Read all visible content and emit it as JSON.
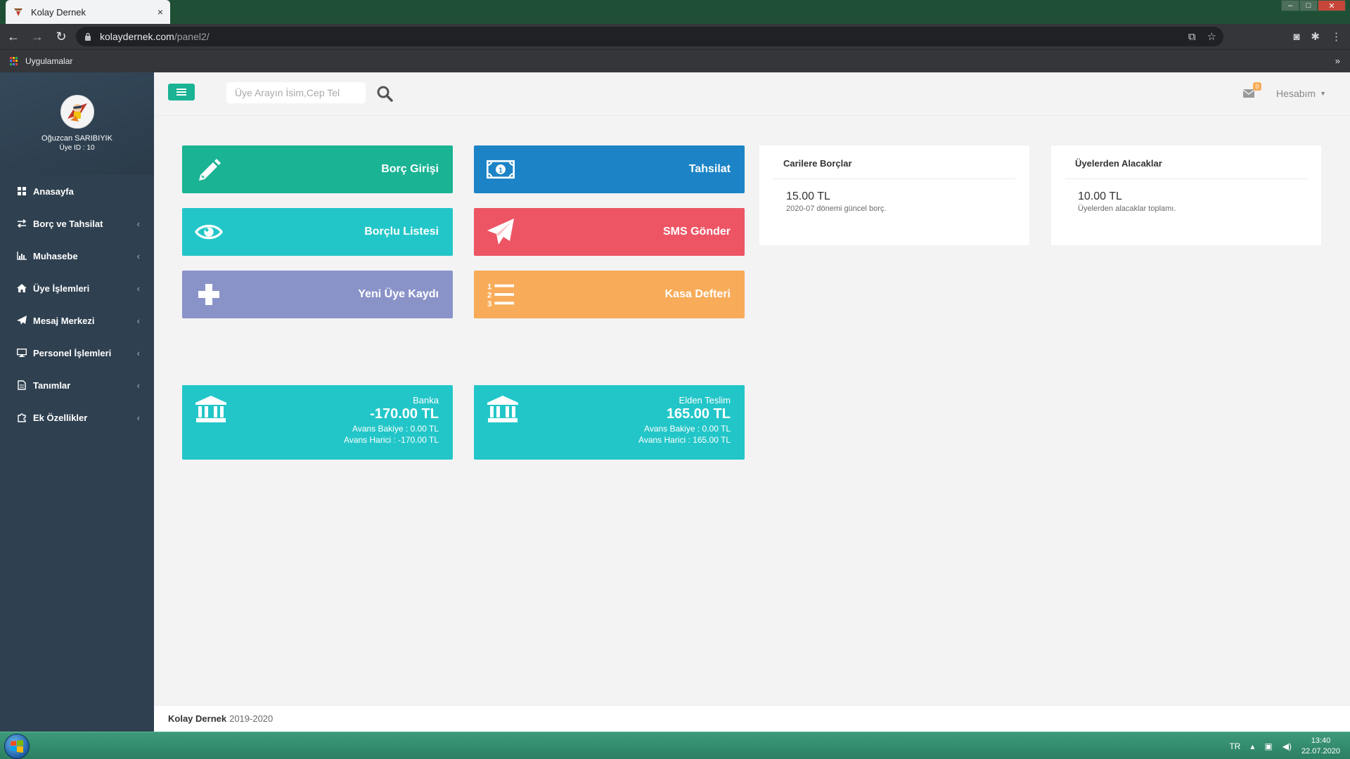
{
  "browser": {
    "tab_title": "Kolay Dernek",
    "tab_close": "×",
    "url_host": "kolaydernek.com",
    "url_path": "/panel2/",
    "bookmark_apps": "Uygulamalar",
    "bookmark_more": "»"
  },
  "profile": {
    "name": "Oğuzcan SARIBIYIK",
    "id_label": "Üye ID : 10"
  },
  "menu": [
    {
      "label": "Anasayfa",
      "icon": "dashboard-icon",
      "has_arrow": false
    },
    {
      "label": "Borç ve Tahsilat",
      "icon": "exchange-icon",
      "has_arrow": true
    },
    {
      "label": "Muhasebe",
      "icon": "bar-chart-icon",
      "has_arrow": true
    },
    {
      "label": "Üye İşlemleri",
      "icon": "home-icon",
      "has_arrow": true
    },
    {
      "label": "Mesaj Merkezi",
      "icon": "paper-plane-icon",
      "has_arrow": true
    },
    {
      "label": "Personel İşlemleri",
      "icon": "desktop-icon",
      "has_arrow": true
    },
    {
      "label": "Tanımlar",
      "icon": "file-icon",
      "has_arrow": true
    },
    {
      "label": "Ek Özellikler",
      "icon": "puzzle-icon",
      "has_arrow": true
    }
  ],
  "menu_arrow": "‹",
  "topbar": {
    "search_placeholder": "Üye Arayın İsim,Cep Tel",
    "mail_count": "0",
    "account_label": "Hesabım"
  },
  "tiles": [
    {
      "label": "Borç Girişi",
      "color": "#1ab394",
      "icon": "pencil-icon"
    },
    {
      "label": "Tahsilat",
      "color": "#1c84c6",
      "icon": "money-icon"
    },
    {
      "label": "Borçlu Listesi",
      "color": "#23c6c8",
      "icon": "eye-icon"
    },
    {
      "label": "SMS Gönder",
      "color": "#ed5565",
      "icon": "paper-plane-icon"
    },
    {
      "label": "Yeni Üye Kaydı",
      "color": "#8a93c8",
      "icon": "plus-icon"
    },
    {
      "label": "Kasa Defteri",
      "color": "#f8ac59",
      "icon": "list-ol-icon"
    }
  ],
  "widgets": [
    {
      "title": "Carilere Borçlar",
      "value": "15.00 TL",
      "sub": "2020-07 dönemi güncel borç."
    },
    {
      "title": "Üyelerden Alacaklar",
      "value": "10.00 TL",
      "sub": "Üyelerden alacaklar toplamı."
    }
  ],
  "banks": [
    {
      "name": "Banka",
      "amount": "-170.00 TL",
      "line1": "Avans Bakiye : 0.00 TL",
      "line2": "Avans Harici : -170.00 TL"
    },
    {
      "name": "Elden Teslim",
      "amount": "165.00 TL",
      "line1": "Avans Bakiye : 0.00 TL",
      "line2": "Avans Harici : 165.00 TL"
    }
  ],
  "footer": {
    "brand": "Kolay Dernek",
    "years": "2019-2020"
  },
  "taskbar": {
    "lang": "TR",
    "time": "13:40",
    "date": "22.07.2020"
  }
}
